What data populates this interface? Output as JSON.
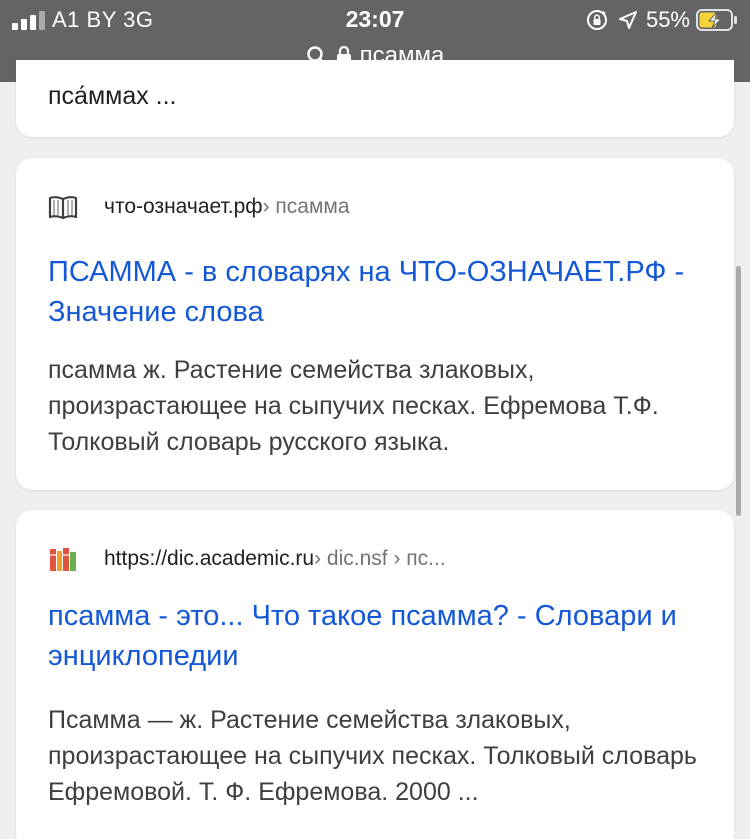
{
  "status": {
    "carrier": "A1 BY  3G",
    "time": "23:07",
    "battery": "55%"
  },
  "address": {
    "query": "псамма"
  },
  "results": [
    {
      "snippet_tail": "пса́ммах ..."
    },
    {
      "domain": "что-означает.рф",
      "crumb": " › псамма",
      "title": "ПСАММА - в словарях на ЧТО-ОЗНАЧАЕТ.РФ - Значение слова",
      "description": "псамма ж. Растение семейства злаковых, произрастающее на сыпучих песках. Ефремова Т.Ф. Толковый словарь русского языка."
    },
    {
      "domain": "https://dic.academic.ru",
      "crumb": " › dic.nsf › пс...",
      "title": "псамма - это... Что такое псамма? - Словари и энциклопедии",
      "description": "Псамма — ж. Растение семейства злаковых, произрастающее на сыпучих песках. Толковый словарь Ефремовой. Т. Ф. Ефремова. 2000 ..."
    }
  ],
  "icons": {
    "signal": "signal-bars-icon",
    "rotation_lock": "rotation-lock-icon",
    "location": "location-arrow-icon",
    "battery": "battery-charging-icon",
    "search": "search-icon",
    "lock": "lock-icon",
    "fav1": "book-icon",
    "fav2": "books-icon"
  },
  "colors": {
    "topbar": "#636466",
    "link": "#1558d6",
    "battery_fill": "#f7d23a"
  }
}
